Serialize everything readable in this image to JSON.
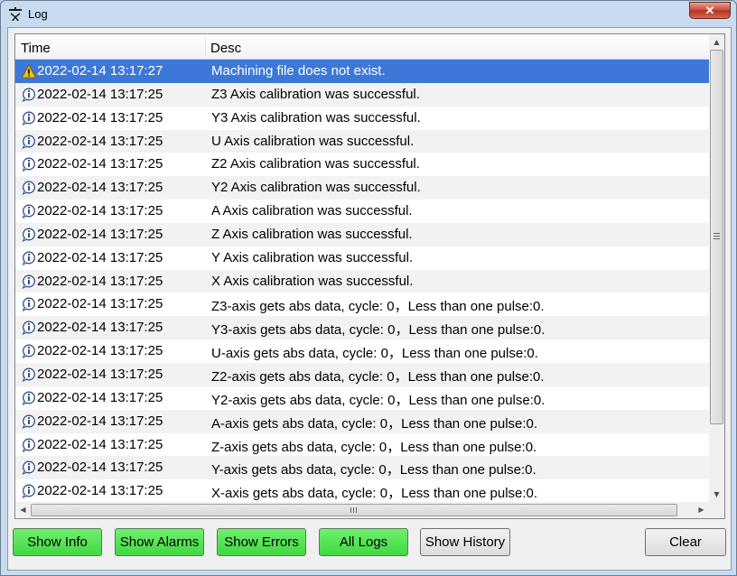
{
  "window": {
    "title": "Log",
    "close_label": "✕"
  },
  "table": {
    "columns": [
      "Time",
      "Desc"
    ],
    "rows": [
      {
        "type": "warning",
        "time": "2022-02-14 13:17:27",
        "desc": "Machining file does not exist.",
        "selected": true
      },
      {
        "type": "info",
        "time": "2022-02-14 13:17:25",
        "desc": "Z3 Axis calibration was successful."
      },
      {
        "type": "info",
        "time": "2022-02-14 13:17:25",
        "desc": "Y3 Axis calibration was successful."
      },
      {
        "type": "info",
        "time": "2022-02-14 13:17:25",
        "desc": "U Axis calibration was successful."
      },
      {
        "type": "info",
        "time": "2022-02-14 13:17:25",
        "desc": "Z2 Axis calibration was successful."
      },
      {
        "type": "info",
        "time": "2022-02-14 13:17:25",
        "desc": "Y2 Axis calibration was successful."
      },
      {
        "type": "info",
        "time": "2022-02-14 13:17:25",
        "desc": "A Axis calibration was successful."
      },
      {
        "type": "info",
        "time": "2022-02-14 13:17:25",
        "desc": "Z Axis calibration was successful."
      },
      {
        "type": "info",
        "time": "2022-02-14 13:17:25",
        "desc": "Y Axis calibration was successful."
      },
      {
        "type": "info",
        "time": "2022-02-14 13:17:25",
        "desc": "X Axis calibration was successful."
      },
      {
        "type": "info",
        "time": "2022-02-14 13:17:25",
        "desc": "Z3-axis gets abs data, cycle: 0，Less than one pulse:0."
      },
      {
        "type": "info",
        "time": "2022-02-14 13:17:25",
        "desc": "Y3-axis gets abs data, cycle: 0，Less than one pulse:0."
      },
      {
        "type": "info",
        "time": "2022-02-14 13:17:25",
        "desc": "U-axis gets abs data, cycle: 0，Less than one pulse:0."
      },
      {
        "type": "info",
        "time": "2022-02-14 13:17:25",
        "desc": "Z2-axis gets abs data, cycle: 0，Less than one pulse:0."
      },
      {
        "type": "info",
        "time": "2022-02-14 13:17:25",
        "desc": "Y2-axis gets abs data, cycle: 0，Less than one pulse:0."
      },
      {
        "type": "info",
        "time": "2022-02-14 13:17:25",
        "desc": "A-axis gets abs data, cycle: 0，Less than one pulse:0."
      },
      {
        "type": "info",
        "time": "2022-02-14 13:17:25",
        "desc": "Z-axis gets abs data, cycle: 0，Less than one pulse:0."
      },
      {
        "type": "info",
        "time": "2022-02-14 13:17:25",
        "desc": "Y-axis gets abs data, cycle: 0，Less than one pulse:0."
      },
      {
        "type": "info",
        "time": "2022-02-14 13:17:25",
        "desc": "X-axis gets abs data, cycle: 0，Less than one pulse:0."
      }
    ]
  },
  "buttons": {
    "show_info": "Show Info",
    "show_alarms": "Show Alarms",
    "show_errors": "Show Errors",
    "all_logs": "All Logs",
    "show_history": "Show History",
    "clear": "Clear"
  },
  "colors": {
    "selection": "#3d78d8",
    "filter_button_active": "#42d742",
    "window_frame": "#c6daf0"
  },
  "icons": {
    "warning": "warning-icon",
    "info": "info-icon",
    "app": "app-icon"
  }
}
